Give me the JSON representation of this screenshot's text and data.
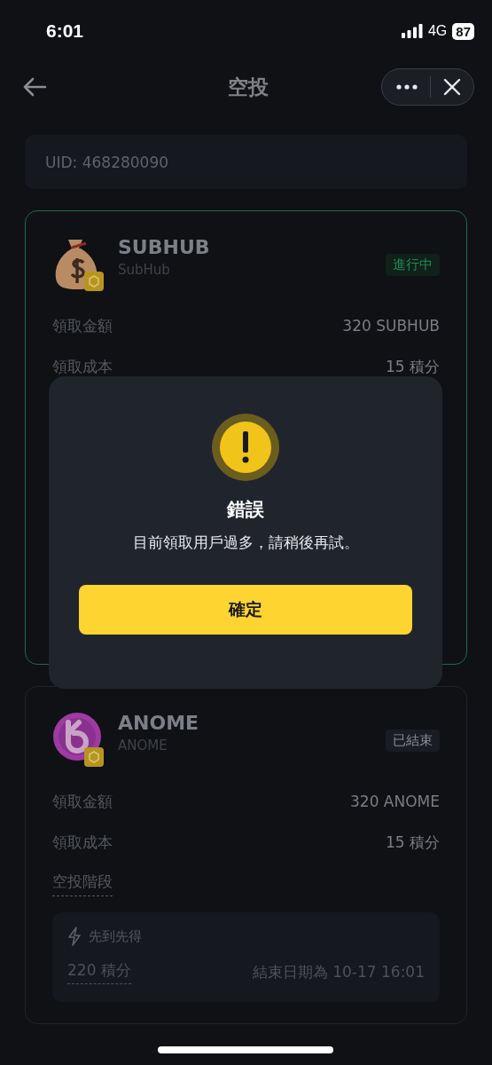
{
  "status_bar": {
    "time": "6:01",
    "network": "4G",
    "battery": "87"
  },
  "header": {
    "title": "空投"
  },
  "uid": "UID: 468280090",
  "airdrops": [
    {
      "symbol": "SUBHUB",
      "name": "SubHub",
      "kind": "bag",
      "status": {
        "kind": "ongoing",
        "label": "進行中"
      },
      "rows": [
        {
          "label": "領取金額",
          "value": "320 SUBHUB"
        },
        {
          "label": "領取成本",
          "value": "15 積分"
        }
      ]
    },
    {
      "symbol": "ANOME",
      "name": "ANOME",
      "kind": "disc",
      "status": {
        "kind": "ended",
        "label": "已結束"
      },
      "rows": [
        {
          "label": "領取金額",
          "value": "320 ANOME"
        },
        {
          "label": "領取成本",
          "value": "15 積分"
        }
      ],
      "stage": {
        "label": "空投階段",
        "tiers": [
          {
            "title": "先到先得",
            "points": "220 積分",
            "end": "結束日期為 10-17 16:01"
          }
        ]
      }
    }
  ],
  "dialog": {
    "title": "錯誤",
    "message": "目前領取用戶過多，請稍後再試。",
    "button": "確定"
  }
}
